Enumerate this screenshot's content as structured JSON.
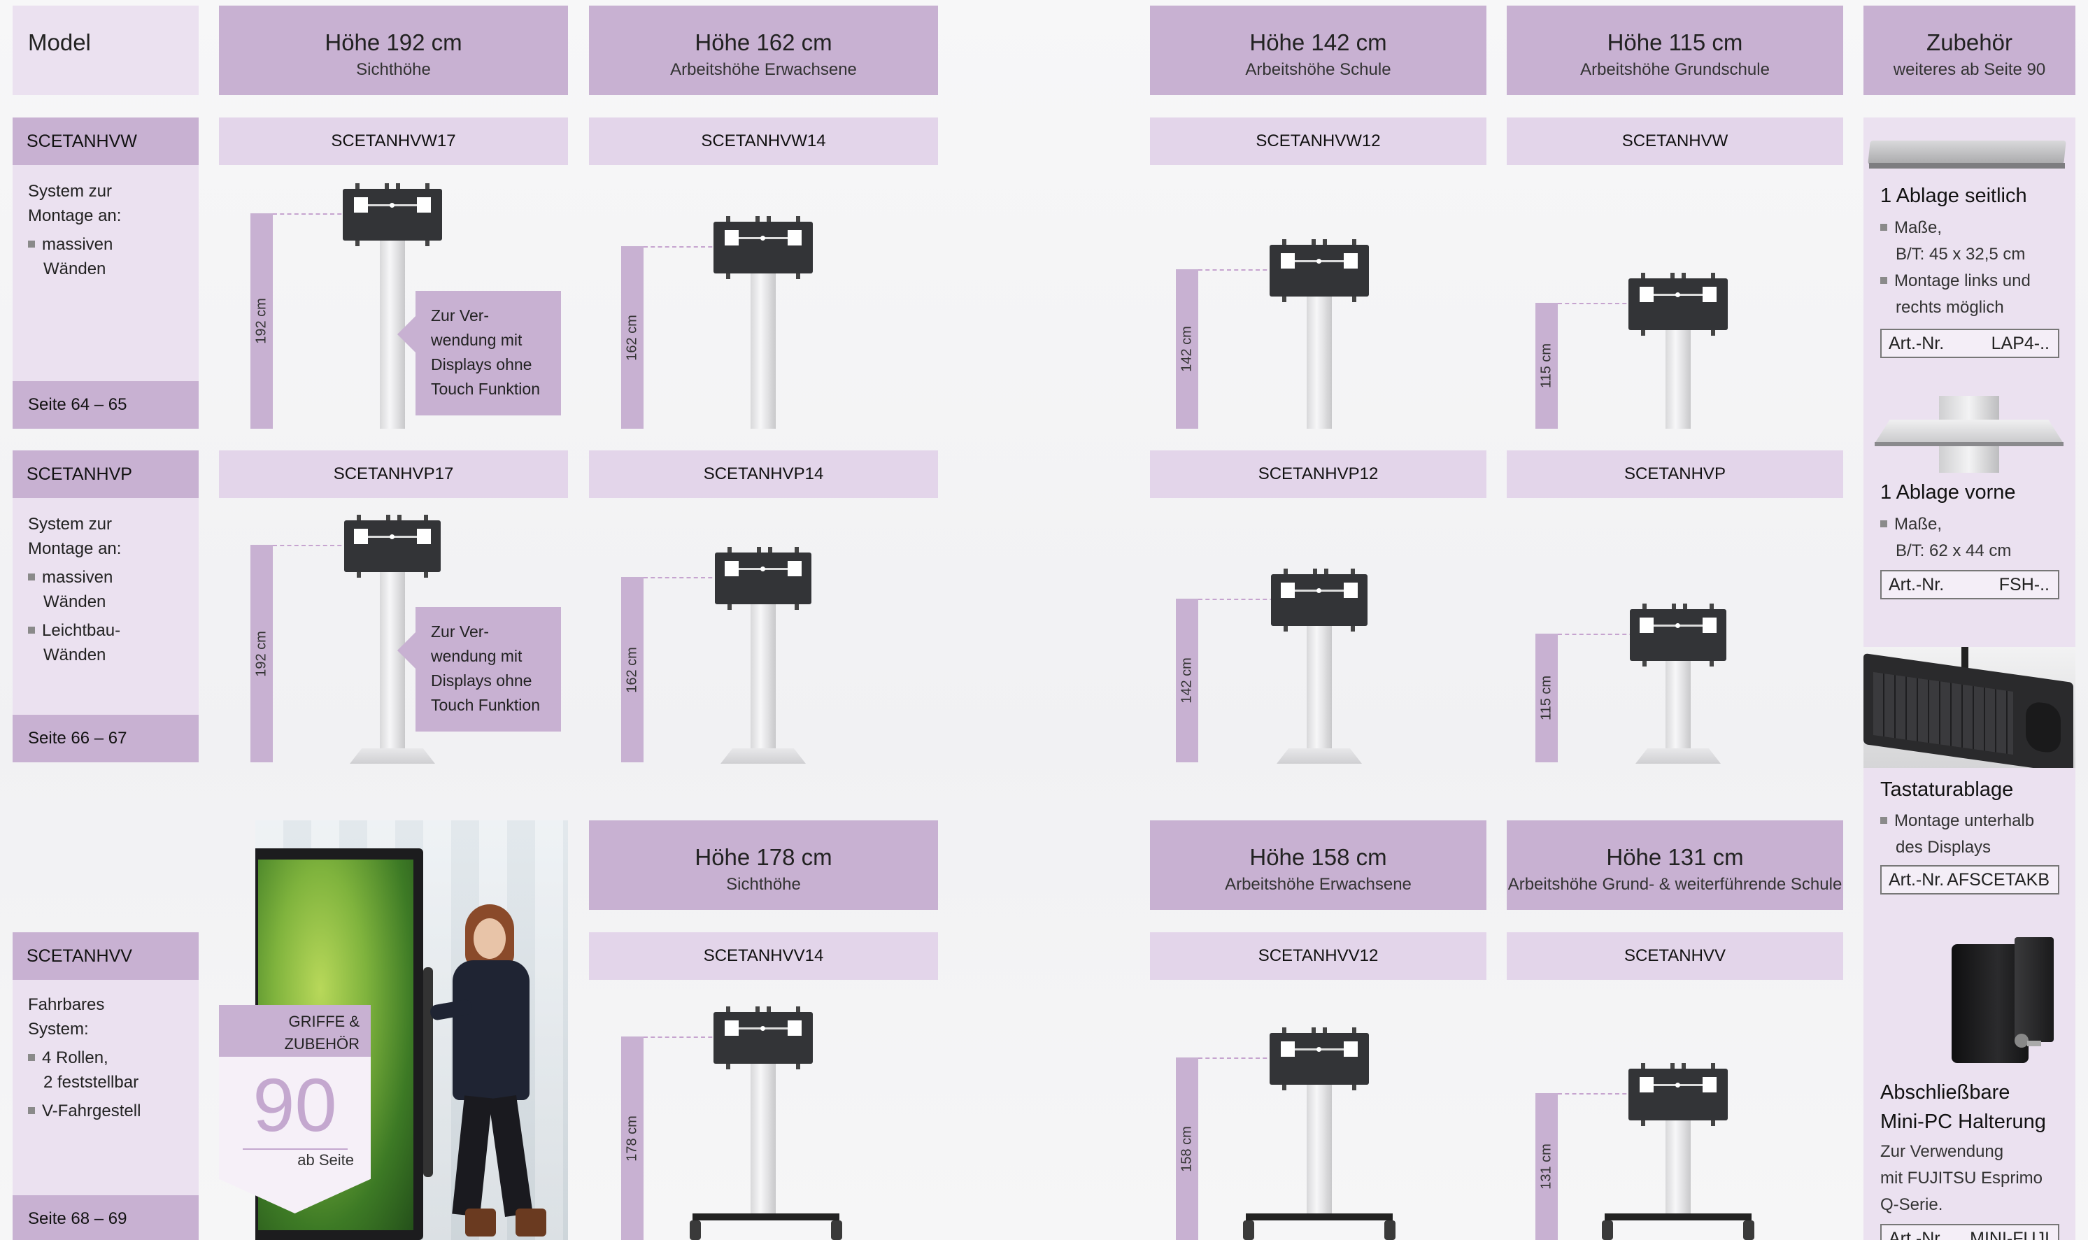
{
  "header": {
    "model": "Model",
    "h192": {
      "title": "Höhe 192 cm",
      "sub": "Sichthöhe"
    },
    "h162": {
      "title": "Höhe 162 cm",
      "sub": "Arbeitshöhe Erwachsene"
    },
    "h142": {
      "title": "Höhe 142 cm",
      "sub": "Arbeitshöhe Schule"
    },
    "h115": {
      "title": "Höhe 115 cm",
      "sub": "Arbeitshöhe Grundschule"
    },
    "zubehoer": {
      "title": "Zubehör",
      "sub": "weiteres ab Seite 90"
    }
  },
  "row1": {
    "tag": "SCETANHVW",
    "desc1": "System zur",
    "desc2": "Montage an:",
    "bullet1a": "massiven",
    "bullet1b": "Wänden",
    "seite": "Seite 64 – 65",
    "codes": [
      "SCETANHVW17",
      "SCETANHVW14",
      "SCETANHVW12",
      "SCETANHVW"
    ],
    "heights": [
      "192 cm",
      "162 cm",
      "142 cm",
      "115 cm"
    ],
    "callout": [
      "Zur Ver-",
      "wendung mit",
      "Displays ohne",
      "Touch Funktion"
    ]
  },
  "row2": {
    "tag": "SCETANHVP",
    "desc1": "System zur",
    "desc2": "Montage an:",
    "bullet1a": "massiven",
    "bullet1b": "Wänden",
    "bullet2a": "Leichtbau-",
    "bullet2b": "Wänden",
    "seite": "Seite 66 – 67",
    "codes": [
      "SCETANHVP17",
      "SCETANHVP14",
      "SCETANHVP12",
      "SCETANHVP"
    ],
    "heights": [
      "192 cm",
      "162 cm",
      "142 cm",
      "115 cm"
    ],
    "callout": [
      "Zur Ver-",
      "wendung mit",
      "Displays ohne",
      "Touch Funktion"
    ]
  },
  "header2": {
    "h178": {
      "title": "Höhe 178 cm",
      "sub": "Sichthöhe"
    },
    "h158": {
      "title": "Höhe 158 cm",
      "sub": "Arbeitshöhe Erwachsene"
    },
    "h131": {
      "title": "Höhe 131 cm",
      "sub": "Arbeitshöhe Grund- & weiterführende Schule"
    }
  },
  "row3": {
    "tag": "SCETANHVV",
    "desc1": "Fahrbares",
    "desc2": "System:",
    "bullet1a": "4 Rollen,",
    "bullet1b": "2 feststellbar",
    "bullet2": "V-Fahrgestell",
    "seite": "Seite 68 – 69",
    "codes": [
      "SCETANHVV14",
      "SCETANHVV12",
      "SCETANHVV"
    ],
    "heights": [
      "178 cm",
      "158 cm",
      "131 cm"
    ]
  },
  "badge": {
    "line1": "GRIFFE &",
    "line2": "ZUBEHÖR",
    "number": "90",
    "ab": "ab Seite"
  },
  "accessories": [
    {
      "title": "1 Ablage seitlich",
      "b1": "Maße,",
      "b1b": "B/T: 45 x 32,5 cm",
      "b2": "Montage links und",
      "b2b": "rechts möglich",
      "art_label": "Art.-Nr.",
      "art": "LAP4-.."
    },
    {
      "title": "1 Ablage vorne",
      "b1": "Maße,",
      "b1b": "B/T: 62 x 44 cm",
      "art_label": "Art.-Nr.",
      "art": "FSH-.."
    },
    {
      "title": "Tastaturablage",
      "b1": "Montage unterhalb",
      "b1b": "des Displays",
      "art_label": "Art.-Nr.",
      "art": "AFSCETAKB"
    },
    {
      "title1": "Abschließbare",
      "title2": "Mini-PC Halterung",
      "t1": "Zur Verwendung",
      "t2": "mit FUJITSU Esprimo",
      "t3": "Q-Serie.",
      "art_label": "Art.-Nr.",
      "art": "MINI-FUJI"
    }
  ],
  "colors": {
    "accent": "#c8b1d2",
    "light": "#e3d5ea",
    "pale": "#ebe1f0"
  }
}
